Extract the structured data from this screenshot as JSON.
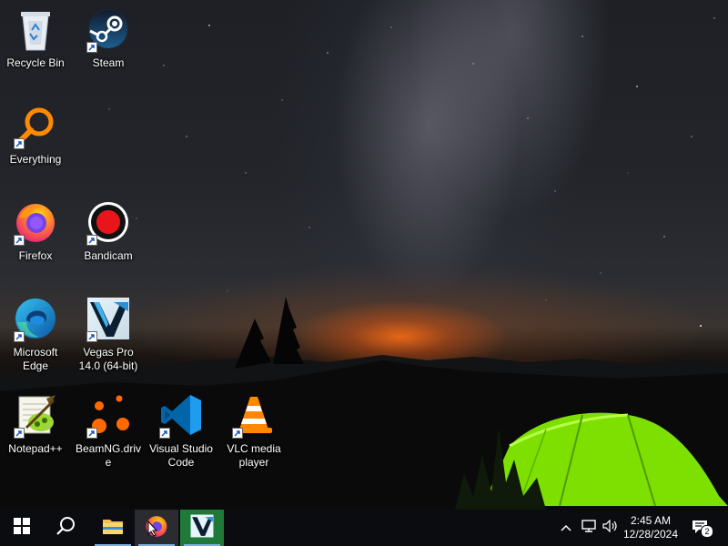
{
  "desktop": {
    "icons": [
      {
        "label": "Recycle Bin",
        "icon": "recycle-bin-icon"
      },
      {
        "label": "Steam",
        "icon": "steam-icon"
      },
      {
        "label": "Everything",
        "icon": "everything-search-icon"
      },
      {
        "label": "Firefox",
        "icon": "firefox-icon"
      },
      {
        "label": "Bandicam",
        "icon": "bandicam-record-icon"
      },
      {
        "label": "Microsoft Edge",
        "icon": "edge-icon"
      },
      {
        "label": "Vegas Pro 14.0 (64-bit)",
        "icon": "vegas-pro-icon"
      },
      {
        "label": "Notepad++",
        "icon": "notepad-plus-plus-icon"
      },
      {
        "label": "BeamNG.drive",
        "icon": "beamng-icon"
      },
      {
        "label": "Visual Studio Code",
        "icon": "vscode-icon"
      },
      {
        "label": "VLC media player",
        "icon": "vlc-icon"
      }
    ]
  },
  "taskbar": {
    "start": "windows-start-icon",
    "search": "search-icon",
    "pinned": [
      {
        "name": "File Explorer",
        "icon": "folder-icon",
        "active": true
      },
      {
        "name": "Firefox",
        "icon": "firefox-icon",
        "active": true
      },
      {
        "name": "Vegas Pro",
        "icon": "vegas-pro-icon",
        "active": true
      }
    ],
    "tray": {
      "chevron": "chevron-up-icon",
      "network": "network-icon",
      "volume": "volume-icon"
    },
    "clock": {
      "time": "2:45 AM",
      "date": "12/28/2024"
    },
    "notifications": {
      "count": "2",
      "icon": "notification-icon"
    }
  },
  "colors": {
    "taskbar_bg": "#0b0c0f",
    "active_indicator": "#7ab0e8",
    "tent_green": "#7ee000",
    "horizon_glow": "#ff6e14"
  }
}
